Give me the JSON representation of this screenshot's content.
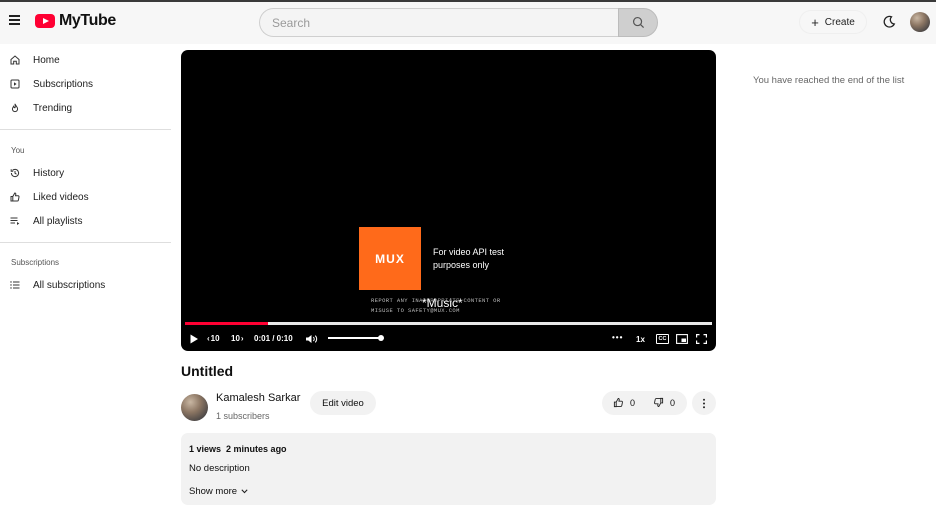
{
  "app": {
    "name": "MyTube"
  },
  "header": {
    "search_placeholder": "Search",
    "create_label": "Create"
  },
  "sidebar": {
    "main": [
      {
        "label": "Home",
        "icon": "home-icon"
      },
      {
        "label": "Subscriptions",
        "icon": "subscriptions-icon"
      },
      {
        "label": "Trending",
        "icon": "flame-icon"
      }
    ],
    "you_heading": "You",
    "you": [
      {
        "label": "History",
        "icon": "history-icon"
      },
      {
        "label": "Liked videos",
        "icon": "thumbs-up-icon"
      },
      {
        "label": "All playlists",
        "icon": "playlist-icon"
      }
    ],
    "subs_heading": "Subscriptions",
    "subs": [
      {
        "label": "All subscriptions",
        "icon": "list-icon"
      }
    ]
  },
  "player": {
    "overlay": {
      "logo_text": "MUX",
      "line1": "For video API test",
      "line2": "purposes only",
      "small1": "REPORT ANY INAPPROPRIATE CONTENT OR",
      "small2": "MISUSE TO SAFETY@MUX.COM"
    },
    "caption": "*Music*",
    "progress_fraction": 0.157,
    "volume_fraction": 1.0,
    "time": "0:01 / 0:10",
    "rewind_label": "10",
    "forward_label": "10",
    "speed": "1x",
    "cc_label": "CC"
  },
  "video": {
    "title": "Untitled",
    "channel": "Kamalesh Sarkar",
    "subscribers": "1 subscribers",
    "edit_label": "Edit video",
    "likes": "0",
    "dislikes": "0",
    "views": "1 views",
    "uploaded": "2 minutes ago",
    "description": "No description",
    "show_more": "Show more"
  },
  "related": {
    "end_message": "You have reached the end of the list"
  },
  "colors": {
    "accent": "#ff0033",
    "mux_orange": "#ff6a1a"
  }
}
